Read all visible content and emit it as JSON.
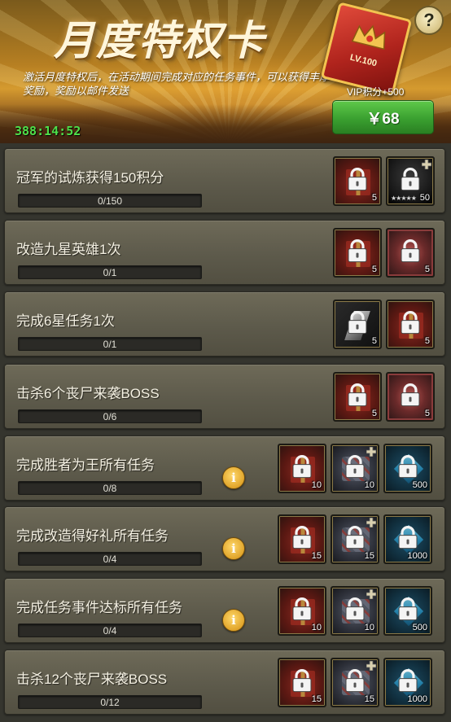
{
  "banner": {
    "title": "月度特权卡",
    "description": "激活月度特权后，在活动期间完成对应的任务事件，可以获得丰厚奖励，奖励以邮件发送",
    "countdown": "388:14:52",
    "card_level": "LV.100",
    "vip_bonus": "VIP积分+500",
    "price_label": "￥68",
    "help_label": "?"
  },
  "tasks": [
    {
      "title": "冠军的试炼获得150积分",
      "progress": "0/150",
      "has_info": false,
      "rewards": [
        {
          "kind": "gift",
          "icon": "gift-box-icon",
          "count": "5"
        },
        {
          "kind": "hero",
          "icon": "hero-fragment-icon",
          "count": "50",
          "stars": "★★★★★"
        }
      ]
    },
    {
      "title": "改造九星英雄1次",
      "progress": "0/1",
      "has_info": false,
      "rewards": [
        {
          "kind": "gift",
          "icon": "gift-box-icon",
          "count": "5"
        },
        {
          "kind": "badge",
          "icon": "winged-badge-icon",
          "count": "5"
        }
      ]
    },
    {
      "title": "完成6星任务1次",
      "progress": "0/1",
      "has_info": false,
      "rewards": [
        {
          "kind": "shard",
          "icon": "silver-shard-icon",
          "count": "5"
        },
        {
          "kind": "gift",
          "icon": "gift-box-icon",
          "count": "5"
        }
      ]
    },
    {
      "title": "击杀6个丧尸来袭BOSS",
      "progress": "0/6",
      "has_info": false,
      "rewards": [
        {
          "kind": "gift",
          "icon": "gift-box-icon",
          "count": "5"
        },
        {
          "kind": "badge",
          "icon": "winged-badge-icon",
          "count": "5"
        }
      ]
    },
    {
      "title": "完成胜者为王所有任务",
      "progress": "0/8",
      "has_info": true,
      "rewards": [
        {
          "kind": "gift",
          "icon": "gift-box-icon",
          "count": "10"
        },
        {
          "kind": "puzzle",
          "icon": "puzzle-fragment-icon",
          "count": "10"
        },
        {
          "kind": "gem",
          "icon": "blue-gem-icon",
          "count": "500"
        }
      ]
    },
    {
      "title": "完成改造得好礼所有任务",
      "progress": "0/4",
      "has_info": true,
      "rewards": [
        {
          "kind": "gift",
          "icon": "gift-box-icon",
          "count": "15"
        },
        {
          "kind": "puzzle",
          "icon": "puzzle-fragment-icon",
          "count": "15"
        },
        {
          "kind": "gem",
          "icon": "blue-gem-icon",
          "count": "1000"
        }
      ]
    },
    {
      "title": "完成任务事件达标所有任务",
      "progress": "0/4",
      "has_info": true,
      "rewards": [
        {
          "kind": "gift",
          "icon": "gift-box-icon",
          "count": "10"
        },
        {
          "kind": "puzzle",
          "icon": "puzzle-fragment-icon",
          "count": "10"
        },
        {
          "kind": "gem",
          "icon": "blue-gem-icon",
          "count": "500"
        }
      ]
    },
    {
      "title": "击杀12个丧尸来袭BOSS",
      "progress": "0/12",
      "has_info": false,
      "rewards": [
        {
          "kind": "gift",
          "icon": "gift-box-icon",
          "count": "15"
        },
        {
          "kind": "puzzle",
          "icon": "puzzle-fragment-icon",
          "count": "15"
        },
        {
          "kind": "gem",
          "icon": "blue-gem-icon",
          "count": "1000"
        }
      ]
    }
  ],
  "info_label": "i",
  "colors": {
    "accent_green": "#3aa030",
    "countdown_green": "#4ee04a",
    "panel": "#5d5a4b",
    "gold": "#e0a42a"
  }
}
